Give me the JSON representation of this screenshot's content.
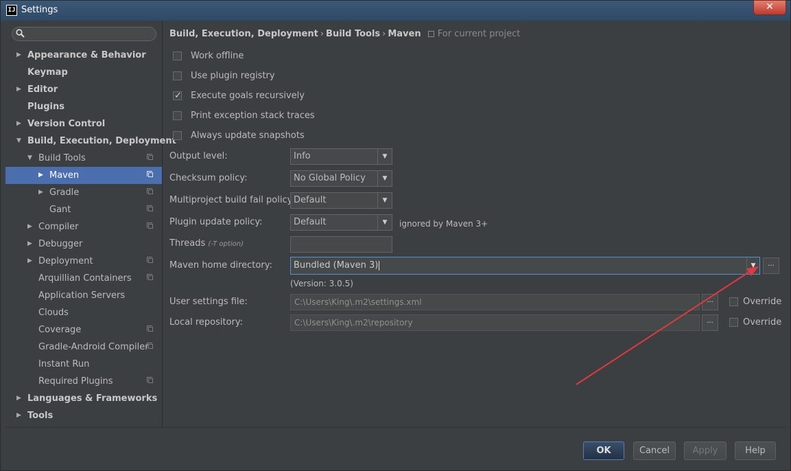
{
  "window": {
    "title": "Settings",
    "app_icon_text": "IJ",
    "close_glyph": "✕"
  },
  "search": {
    "placeholder": "",
    "icon": "search-icon"
  },
  "tree": [
    {
      "label": "Appearance & Behavior",
      "bold": true,
      "arrow": "▶",
      "indent": 0
    },
    {
      "label": "Keymap",
      "bold": true,
      "arrow": "",
      "indent": 0
    },
    {
      "label": "Editor",
      "bold": true,
      "arrow": "▶",
      "indent": 0
    },
    {
      "label": "Plugins",
      "bold": true,
      "arrow": "",
      "indent": 0
    },
    {
      "label": "Version Control",
      "bold": true,
      "arrow": "▶",
      "indent": 0
    },
    {
      "label": "Build, Execution, Deployment",
      "bold": true,
      "arrow": "▼",
      "indent": 0
    },
    {
      "label": "Build Tools",
      "bold": false,
      "arrow": "▼",
      "indent": 1,
      "copy": true
    },
    {
      "label": "Maven",
      "bold": false,
      "arrow": "▶",
      "indent": 2,
      "copy": true,
      "selected": true
    },
    {
      "label": "Gradle",
      "bold": false,
      "arrow": "▶",
      "indent": 2,
      "copy": true
    },
    {
      "label": "Gant",
      "bold": false,
      "arrow": "",
      "indent": 2,
      "copy": true
    },
    {
      "label": "Compiler",
      "bold": false,
      "arrow": "▶",
      "indent": 1,
      "copy": true
    },
    {
      "label": "Debugger",
      "bold": false,
      "arrow": "▶",
      "indent": 1
    },
    {
      "label": "Deployment",
      "bold": false,
      "arrow": "▶",
      "indent": 1,
      "copy": true
    },
    {
      "label": "Arquillian Containers",
      "bold": false,
      "arrow": "",
      "indent": 1,
      "copy": true
    },
    {
      "label": "Application Servers",
      "bold": false,
      "arrow": "",
      "indent": 1
    },
    {
      "label": "Clouds",
      "bold": false,
      "arrow": "",
      "indent": 1
    },
    {
      "label": "Coverage",
      "bold": false,
      "arrow": "",
      "indent": 1,
      "copy": true
    },
    {
      "label": "Gradle-Android Compiler",
      "bold": false,
      "arrow": "",
      "indent": 1,
      "copy": true
    },
    {
      "label": "Instant Run",
      "bold": false,
      "arrow": "",
      "indent": 1
    },
    {
      "label": "Required Plugins",
      "bold": false,
      "arrow": "",
      "indent": 1,
      "copy": true
    },
    {
      "label": "Languages & Frameworks",
      "bold": true,
      "arrow": "▶",
      "indent": 0
    },
    {
      "label": "Tools",
      "bold": true,
      "arrow": "▶",
      "indent": 0
    }
  ],
  "breadcrumb": {
    "part1": "Build, Execution, Deployment",
    "part2": "Build Tools",
    "part3": "Maven",
    "sep": "›",
    "scope": "For current project"
  },
  "checkboxes": [
    {
      "label": "Work offline",
      "checked": false
    },
    {
      "label": "Use plugin registry",
      "checked": false
    },
    {
      "label": "Execute goals recursively",
      "checked": true
    },
    {
      "label": "Print exception stack traces",
      "checked": false
    },
    {
      "label": "Always update snapshots",
      "checked": false
    }
  ],
  "fields": {
    "output_level": {
      "label": "Output level:",
      "value": "Info"
    },
    "checksum_policy": {
      "label": "Checksum policy:",
      "value": "No Global Policy"
    },
    "multiproject_policy": {
      "label": "Multiproject build fail policy:",
      "value": "Default"
    },
    "plugin_update_policy": {
      "label": "Plugin update policy:",
      "value": "Default",
      "note": "ignored by Maven 3+"
    },
    "threads": {
      "label": "Threads",
      "hint": "(-T option)",
      "value": ""
    },
    "maven_home": {
      "label": "Maven home directory:",
      "value": "Bundled (Maven 3)",
      "version": "(Version: 3.0.5)"
    },
    "user_settings": {
      "label": "User settings file:",
      "value": "C:\\Users\\King\\.m2\\settings.xml",
      "override": "Override"
    },
    "local_repo": {
      "label": "Local repository:",
      "value": "C:\\Users\\King\\.m2\\repository",
      "override": "Override"
    }
  },
  "glyphs": {
    "dropdown": "▼",
    "ellipsis": "...",
    "check": "✓"
  },
  "buttons": {
    "ok": "OK",
    "cancel": "Cancel",
    "apply": "Apply",
    "help": "Help"
  },
  "colors": {
    "accent": "#4b6eaf",
    "annotation": "#e0393e"
  }
}
